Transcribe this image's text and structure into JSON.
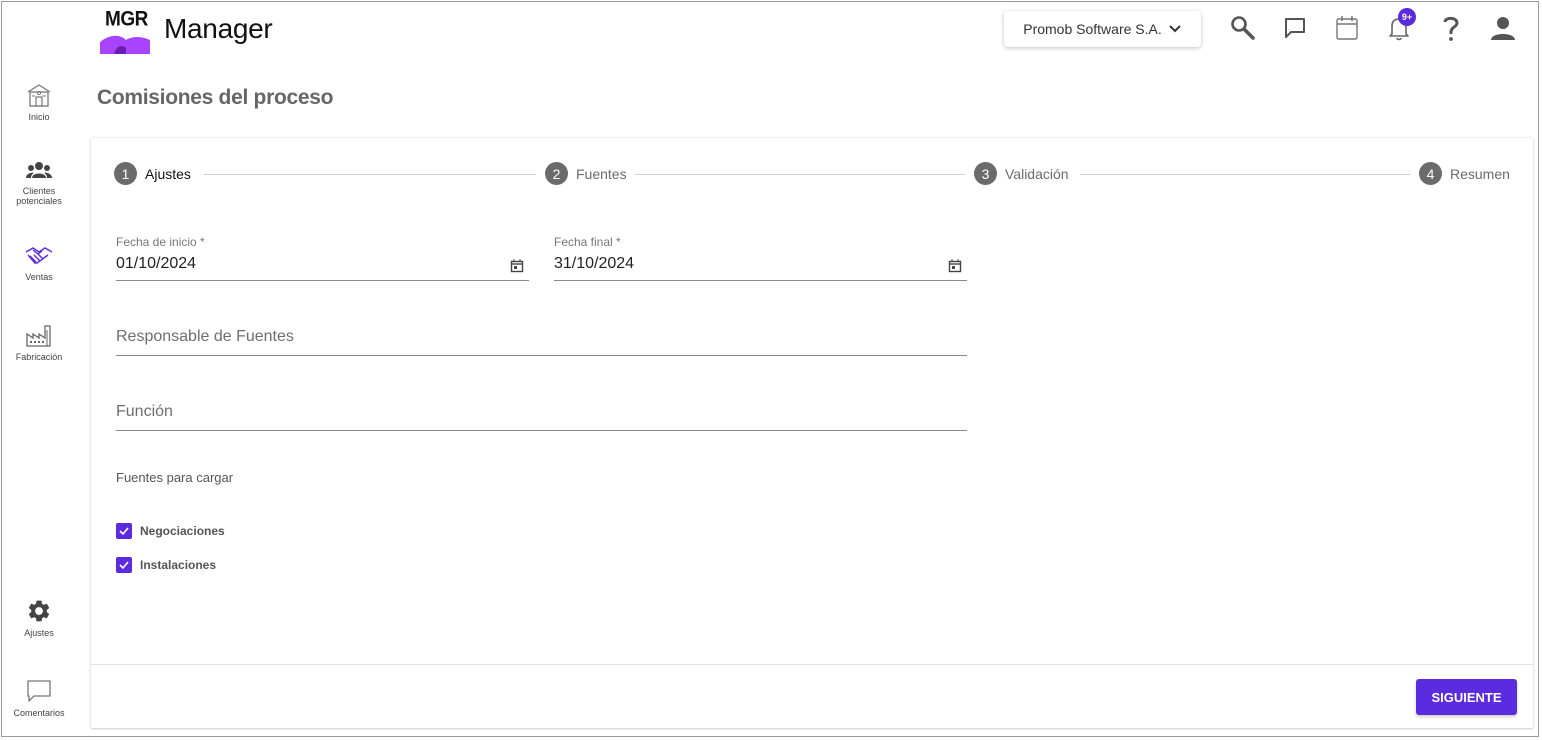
{
  "sidebar": {
    "items": [
      {
        "label": "Inicio",
        "icon": "home-icon"
      },
      {
        "label": "Clientes\npotenciales",
        "icon": "people-icon"
      },
      {
        "label": "Ventas",
        "icon": "handshake-icon"
      },
      {
        "label": "Fabricación",
        "icon": "factory-icon"
      }
    ],
    "bottom": [
      {
        "label": "Ajustes",
        "icon": "gear-icon"
      },
      {
        "label": "Comentarios",
        "icon": "comment-icon"
      }
    ]
  },
  "header": {
    "logo_text": "MGR",
    "app_name": "Manager",
    "company": "Promob Software S.A.",
    "notifications_badge": "9+"
  },
  "page": {
    "title": "Comisiones del proceso"
  },
  "stepper": {
    "steps": [
      {
        "number": "1",
        "label": "Ajustes"
      },
      {
        "number": "2",
        "label": "Fuentes"
      },
      {
        "number": "3",
        "label": "Validación"
      },
      {
        "number": "4",
        "label": "Resumen"
      }
    ],
    "active_step": 1
  },
  "form": {
    "start_date": {
      "label": "Fecha de inicio *",
      "value": "01/10/2024"
    },
    "end_date": {
      "label": "Fecha final *",
      "value": "31/10/2024"
    },
    "responsible": {
      "placeholder": "Responsable de Fuentes",
      "value": ""
    },
    "function": {
      "placeholder": "Función",
      "value": ""
    },
    "sources_label": "Fuentes para cargar",
    "sources": [
      {
        "label": "Negociaciones",
        "checked": true
      },
      {
        "label": "Instalaciones",
        "checked": true
      }
    ],
    "next_button": "SIGUIENTE"
  },
  "colors": {
    "accent": "#5b2be0",
    "logo_purple": "#a843ff",
    "step_inactive": "#6b6b6b"
  }
}
